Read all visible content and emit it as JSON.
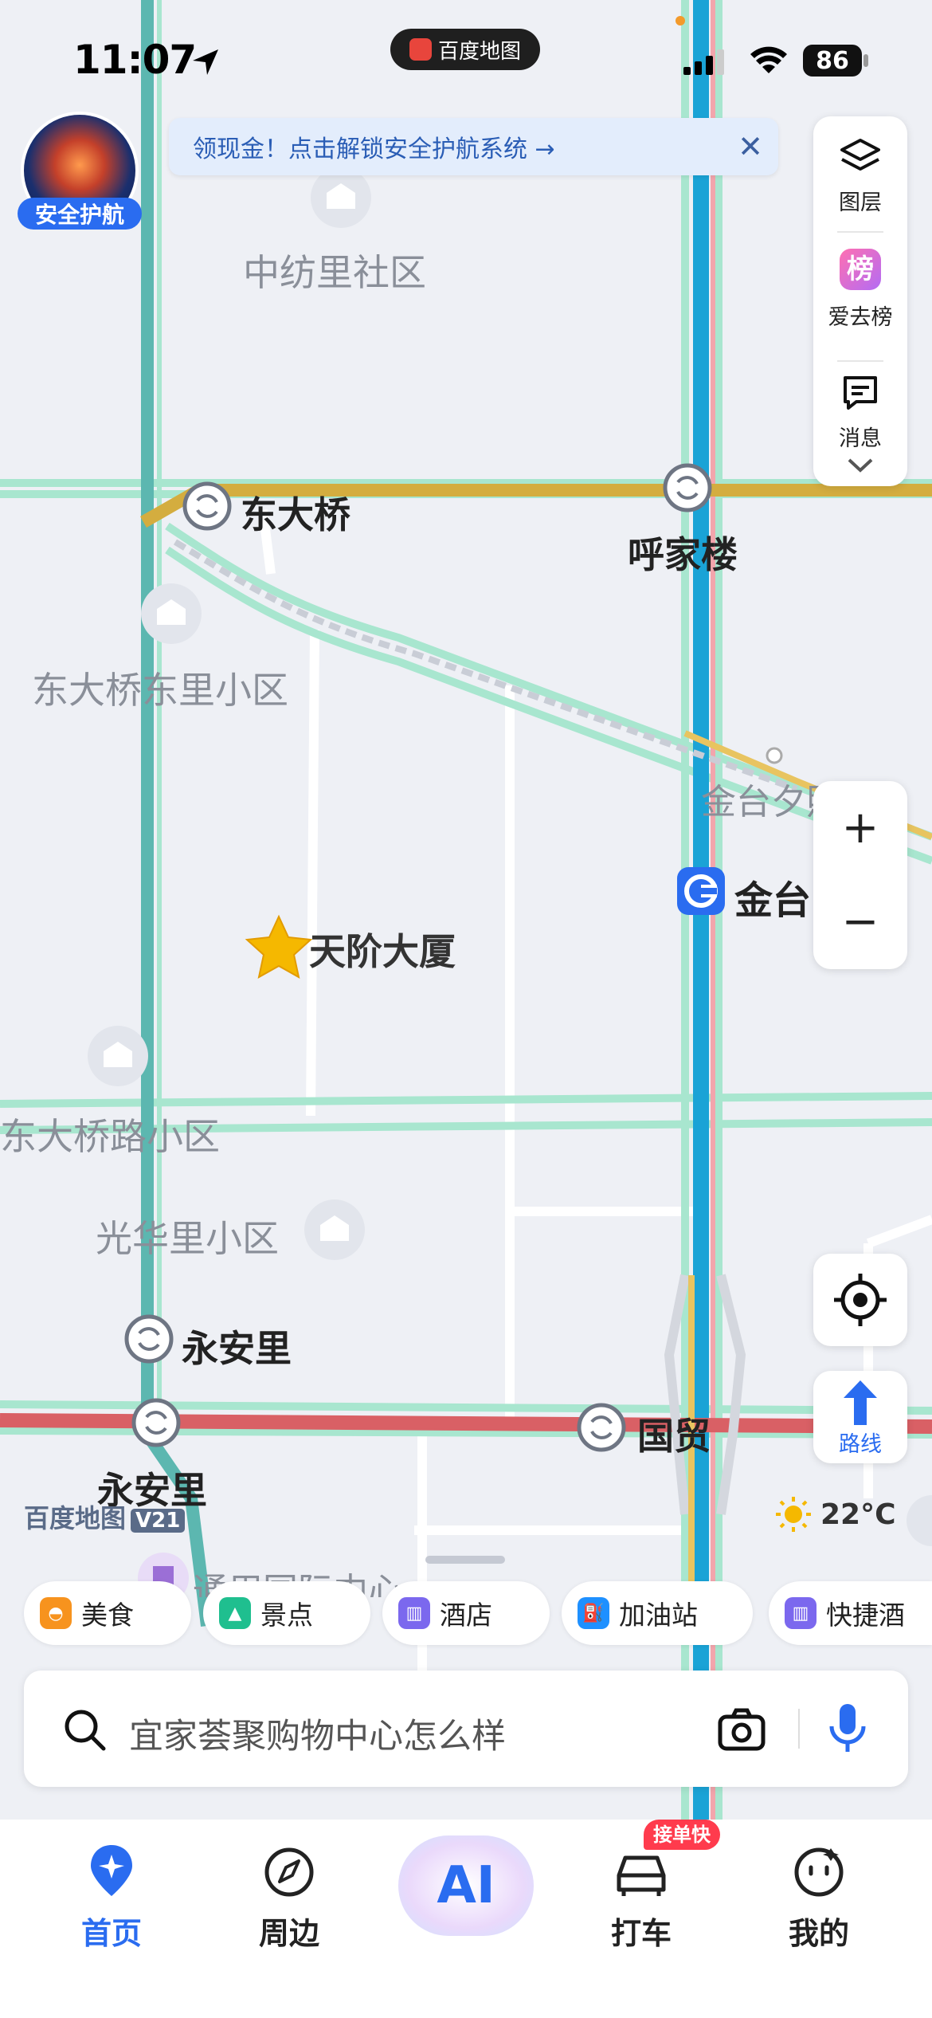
{
  "status_bar": {
    "time": "11:07",
    "app_pill": "百度地图",
    "battery": "86"
  },
  "safety_badge": {
    "label": "安全护航"
  },
  "banner": {
    "text": "领现金！点击解锁安全护航系统 →",
    "close": "✕"
  },
  "right_panel": {
    "layers": "图层",
    "ranking_icon_text": "榜",
    "ranking": "爱去榜",
    "messages": "消息"
  },
  "zoom": {
    "in": "+",
    "out": "−"
  },
  "route_button": {
    "label": "路线"
  },
  "map": {
    "labels": {
      "zhongfangli": "中纺里社区",
      "dongdaqiao": "东大桥",
      "hujialou": "呼家楼",
      "dongdaqiao_dongli": "东大桥东里小区",
      "jintai_xizhao": "金台夕照",
      "jintai": "金台",
      "tianjie": "天阶大厦",
      "dongdaqiaolu": "东大桥路小区",
      "guanghuali": "光华里小区",
      "yonganli_1": "永安里",
      "yonganli_2": "永安里",
      "guomao": "国贸",
      "tongli": "通用国际中心"
    }
  },
  "brand": {
    "name": "百度地图",
    "version": "V21"
  },
  "weather": {
    "temp": "22°C"
  },
  "categories": [
    {
      "label": "美食",
      "color": "#f7931e"
    },
    {
      "label": "景点",
      "color": "#1fbf8f"
    },
    {
      "label": "酒店",
      "color": "#7b68ee"
    },
    {
      "label": "加油站",
      "color": "#1e90ff"
    },
    {
      "label": "快捷酒",
      "color": "#7b68ee"
    }
  ],
  "search": {
    "placeholder": "宜家荟聚购物中心怎么样"
  },
  "tabs": {
    "home": "首页",
    "nearby": "周边",
    "ai": "AI",
    "taxi": "打车",
    "taxi_badge": "接单快",
    "mine": "我的"
  }
}
